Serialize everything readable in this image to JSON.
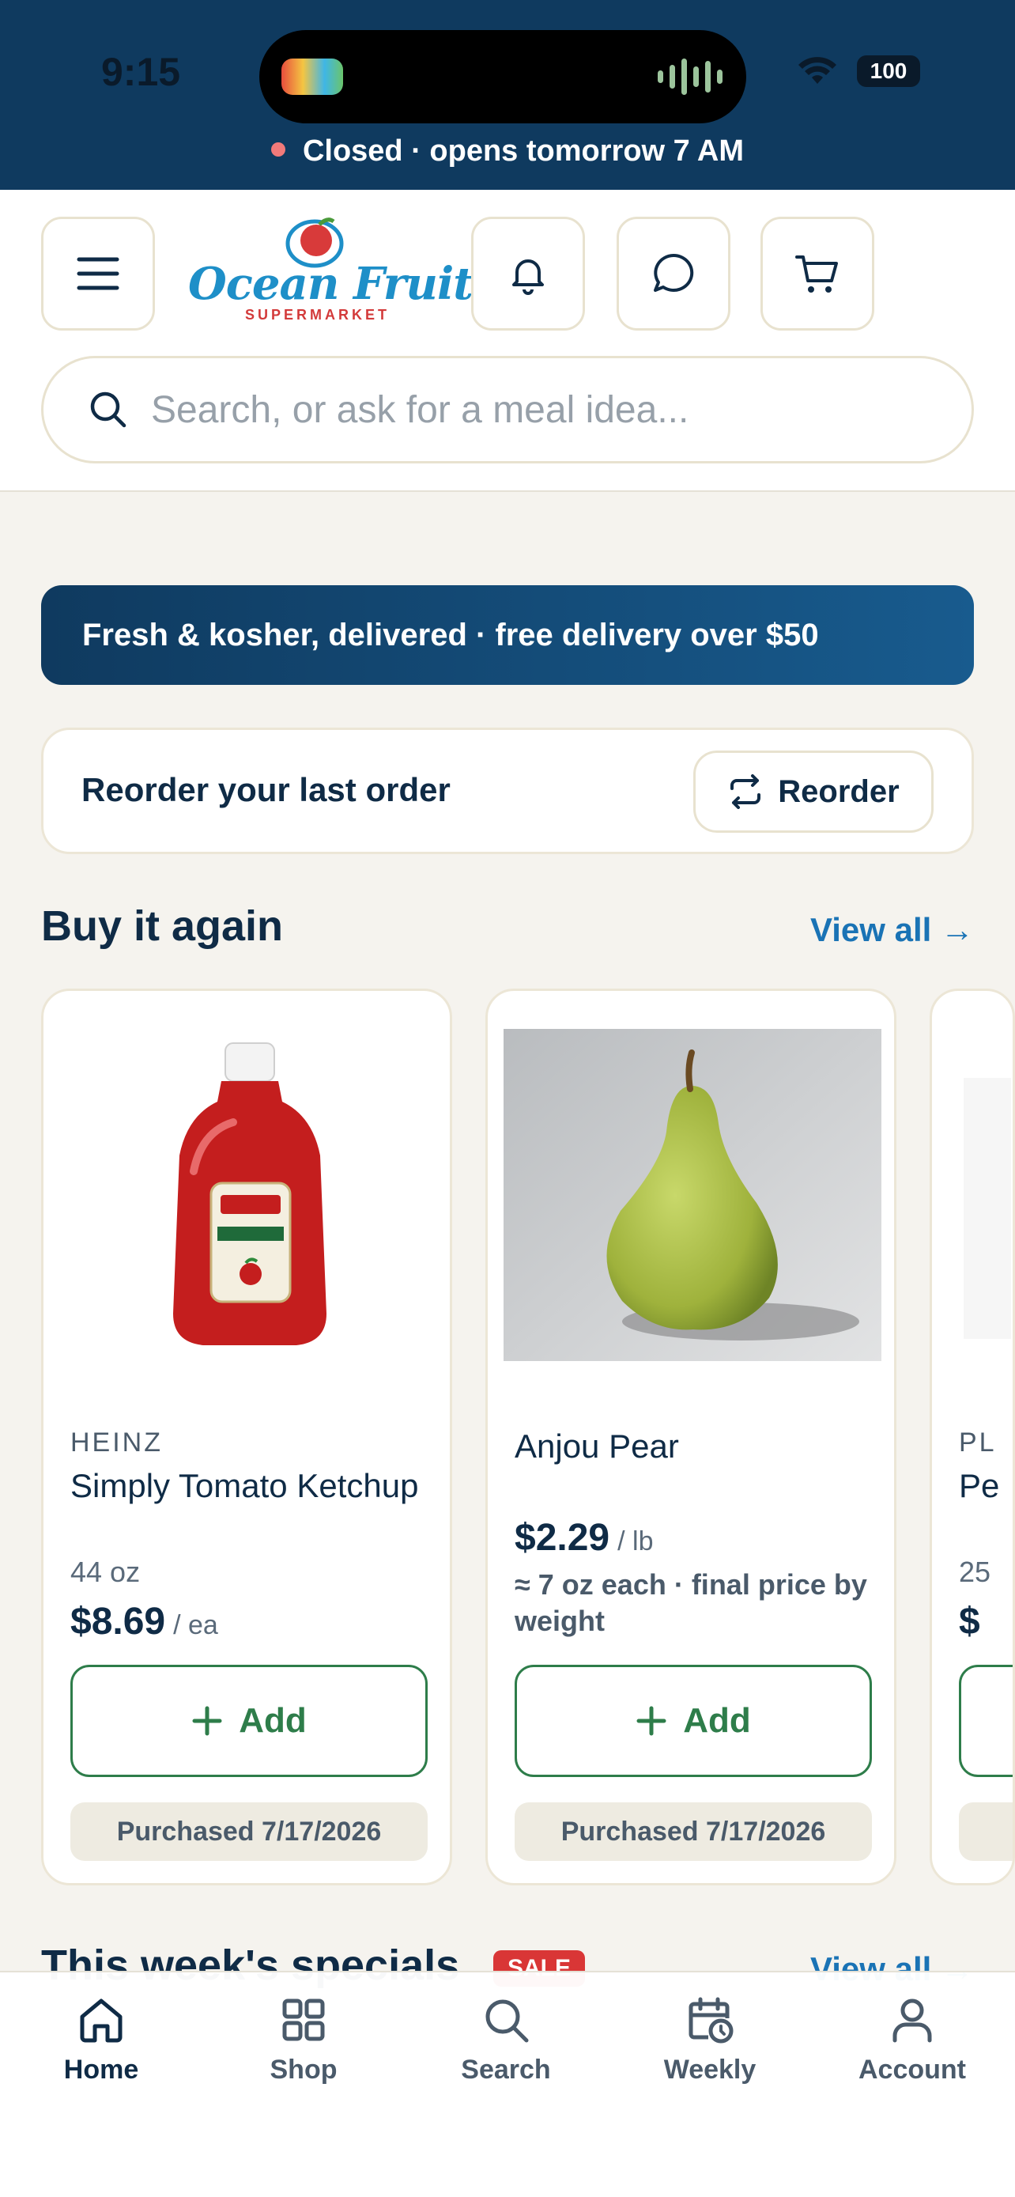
{
  "status_bar": {
    "time": "9:15",
    "battery": "100",
    "store_status": "Closed · opens tomorrow 7 AM"
  },
  "header": {
    "logo_text": "Ocean Fruit",
    "logo_sub": "SUPERMARKET",
    "icons": [
      "menu-icon",
      "bell-icon",
      "chat-icon",
      "cart-icon"
    ]
  },
  "search": {
    "placeholder": "Search, or ask for a meal idea..."
  },
  "promo": {
    "text": "Fresh & kosher, delivered · free delivery over $50"
  },
  "reorder": {
    "label": "Reorder your last order",
    "button": "Reorder"
  },
  "buy_again": {
    "title": "Buy it again",
    "view_all": "View all →",
    "products": [
      {
        "brand": "HEINZ",
        "name": "Simply Tomato Ketchup",
        "size": "44 oz",
        "price": "$8.69",
        "unit": "/ ea",
        "note": "",
        "add": "Add",
        "purchased": "Purchased 7/17/2026"
      },
      {
        "brand": "",
        "name": "Anjou Pear",
        "size": "",
        "price": "$2.29",
        "unit": "/ lb",
        "note": "≈ 7 oz each · final price by weight",
        "add": "Add",
        "purchased": "Purchased 7/17/2026"
      },
      {
        "brand": "PL",
        "name": "Pe",
        "size": "25",
        "price": "$",
        "unit": "",
        "note": "",
        "add": "",
        "purchased": ""
      }
    ]
  },
  "specials": {
    "title": "This week's specials",
    "badge": "SALE",
    "view_all": "View all →"
  },
  "tabbar": {
    "tabs": [
      {
        "label": "Home",
        "icon": "home-icon",
        "active": true
      },
      {
        "label": "Shop",
        "icon": "grid-icon",
        "active": false
      },
      {
        "label": "Search",
        "icon": "search-icon",
        "active": false
      },
      {
        "label": "Weekly",
        "icon": "calendar-clock-icon",
        "active": false
      },
      {
        "label": "Account",
        "icon": "user-icon",
        "active": false
      }
    ]
  },
  "colors": {
    "navy": "#0f3a5f",
    "green": "#2e7d4a",
    "link": "#1a73b5",
    "sale": "#d93636"
  }
}
